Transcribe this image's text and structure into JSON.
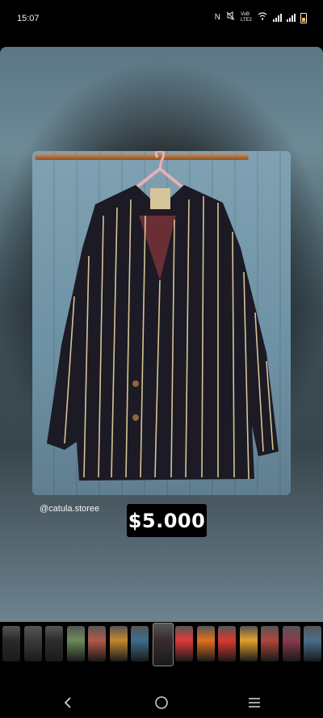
{
  "status_bar": {
    "time": "15:07",
    "network_label": "VoB LTE2",
    "icons": [
      "nfc-icon",
      "mute-icon",
      "volte-icon",
      "wifi-icon",
      "signal-icon",
      "signal-icon",
      "battery-icon"
    ]
  },
  "post": {
    "handle": "@catula.storee",
    "price": "$5.000",
    "image": "striped-blazer-on-hanger"
  },
  "thumbnails": {
    "count": 15,
    "selected_index": 7,
    "colors": [
      "#2a2a2a",
      "#3a3a3a",
      "#2e2e2e",
      "#6b8a5a",
      "#b05a4a",
      "#c4882f",
      "#3d6e8c",
      "#3a2a2e",
      "#e03a3a",
      "#e0701c",
      "#d83a2e",
      "#e2a02a",
      "#b0453a",
      "#8a3a4a",
      "#4a6e8a"
    ]
  },
  "nav": {
    "back": "back-icon",
    "home": "home-icon",
    "recents": "recents-icon"
  }
}
